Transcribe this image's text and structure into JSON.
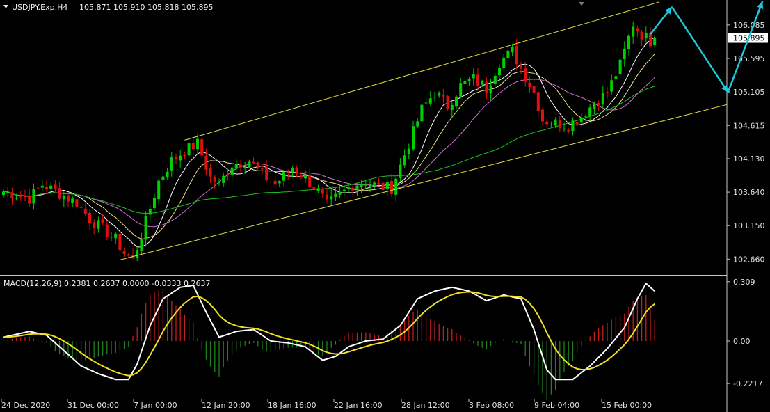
{
  "header": {
    "symbol": "USDJPY.Exp,H4",
    "ohlc": "105.871 105.910 105.818 105.895",
    "current_price": "105.895"
  },
  "macd": {
    "label": "MACD(12,26,9) 0.2381 0.2637 0.0000 -0.0333 0.2637",
    "y_ticks": [
      "0.309",
      "0.00",
      "-0.2217"
    ]
  },
  "colors": {
    "background": "#000000",
    "bull_candle": "#00d000",
    "bear_candle": "#e01010",
    "channel": "#e8e040",
    "ma_fast": "#ffffff",
    "ma_mid": "#f0e68c",
    "ma_slow": "#d070d0",
    "ma_long": "#20c020",
    "arrow": "#1ec8d8",
    "macd_line": "#ffffff",
    "signal_line": "#f0e020",
    "hist_pos": "#c02020",
    "hist_neg": "#208020"
  },
  "chart_data": {
    "type": "candlestick",
    "timeframe": "H4",
    "ylim": [
      102.45,
      106.45
    ],
    "y_ticks": [
      "106.085",
      "105.595",
      "105.105",
      "104.615",
      "104.130",
      "103.640",
      "103.150",
      "102.660"
    ],
    "x_ticks": [
      "24 Dec 2020",
      "31 Dec 00:00",
      "7 Jan 00:00",
      "12 Jan 20:00",
      "18 Jan 16:00",
      "22 Jan 16:00",
      "28 Jan 12:00",
      "3 Feb 08:00",
      "9 Feb 04:00",
      "15 Feb 00:00"
    ],
    "close_path": [
      [
        0,
        103.65
      ],
      [
        6,
        103.55
      ],
      [
        9,
        103.75
      ],
      [
        13,
        103.62
      ],
      [
        17,
        103.48
      ],
      [
        20,
        103.25
      ],
      [
        23,
        103.1
      ],
      [
        26,
        102.95
      ],
      [
        28,
        102.75
      ],
      [
        30,
        102.65
      ],
      [
        33,
        103.2
      ],
      [
        36,
        103.8
      ],
      [
        39,
        104.1
      ],
      [
        42,
        104.25
      ],
      [
        45,
        104.35
      ],
      [
        48,
        103.85
      ],
      [
        50,
        103.75
      ],
      [
        53,
        104.05
      ],
      [
        57,
        104.1
      ],
      [
        60,
        103.9
      ],
      [
        63,
        103.75
      ],
      [
        67,
        104.0
      ],
      [
        70,
        103.85
      ],
      [
        73,
        103.65
      ],
      [
        75,
        103.45
      ],
      [
        78,
        103.6
      ],
      [
        81,
        103.75
      ],
      [
        84,
        103.8
      ],
      [
        87,
        103.72
      ],
      [
        90,
        103.7
      ],
      [
        94,
        104.35
      ],
      [
        97,
        104.85
      ],
      [
        100,
        105.1
      ],
      [
        103,
        104.9
      ],
      [
        106,
        105.2
      ],
      [
        109,
        105.3
      ],
      [
        112,
        105.15
      ],
      [
        115,
        105.55
      ],
      [
        118,
        105.7
      ],
      [
        120,
        105.45
      ],
      [
        123,
        105.1
      ],
      [
        125,
        104.7
      ],
      [
        128,
        104.65
      ],
      [
        131,
        104.62
      ],
      [
        134,
        104.75
      ],
      [
        137,
        104.95
      ],
      [
        140,
        105.1
      ],
      [
        143,
        105.5
      ],
      [
        146,
        106.1
      ],
      [
        148,
        105.95
      ],
      [
        150,
        105.85
      ],
      [
        151,
        105.895
      ]
    ],
    "moving_averages": [
      {
        "key": "ma_fast",
        "period": 8
      },
      {
        "key": "ma_mid",
        "period": 13
      },
      {
        "key": "ma_slow",
        "period": 21
      },
      {
        "key": "ma_long",
        "period": 55
      }
    ],
    "channel": {
      "upper": [
        [
          42,
          104.4
        ],
        [
          152,
          106.42
        ]
      ],
      "lower": [
        [
          27,
          102.65
        ],
        [
          168,
          104.92
        ]
      ]
    },
    "forecast_arrows": [
      {
        "from": [
          150,
          105.95
        ],
        "to": [
          155,
          106.35
        ]
      },
      {
        "from": [
          155,
          106.35
        ],
        "to": [
          168,
          105.1
        ]
      },
      {
        "from": [
          168,
          105.1
        ],
        "to": [
          176,
          106.45
        ]
      }
    ],
    "macd": {
      "ylim": [
        -0.29,
        0.33
      ],
      "zero": 0.0,
      "macd_path": [
        [
          0,
          0.02
        ],
        [
          6,
          0.05
        ],
        [
          10,
          0.03
        ],
        [
          14,
          -0.05
        ],
        [
          18,
          -0.13
        ],
        [
          22,
          -0.17
        ],
        [
          26,
          -0.2
        ],
        [
          29,
          -0.2
        ],
        [
          31,
          -0.12
        ],
        [
          34,
          0.08
        ],
        [
          37,
          0.22
        ],
        [
          41,
          0.28
        ],
        [
          44,
          0.29
        ],
        [
          47,
          0.15
        ],
        [
          50,
          0.02
        ],
        [
          54,
          0.05
        ],
        [
          58,
          0.06
        ],
        [
          62,
          0.0
        ],
        [
          66,
          -0.01
        ],
        [
          70,
          -0.03
        ],
        [
          74,
          -0.1
        ],
        [
          77,
          -0.08
        ],
        [
          80,
          -0.03
        ],
        [
          84,
          0.0
        ],
        [
          88,
          0.01
        ],
        [
          92,
          0.08
        ],
        [
          96,
          0.22
        ],
        [
          100,
          0.26
        ],
        [
          104,
          0.28
        ],
        [
          108,
          0.26
        ],
        [
          112,
          0.21
        ],
        [
          116,
          0.24
        ],
        [
          120,
          0.22
        ],
        [
          123,
          0.06
        ],
        [
          126,
          -0.15
        ],
        [
          128,
          -0.2
        ],
        [
          132,
          -0.2
        ],
        [
          136,
          -0.13
        ],
        [
          140,
          -0.04
        ],
        [
          144,
          0.07
        ],
        [
          147,
          0.22
        ],
        [
          149,
          0.3
        ],
        [
          151,
          0.26
        ]
      ]
    }
  }
}
